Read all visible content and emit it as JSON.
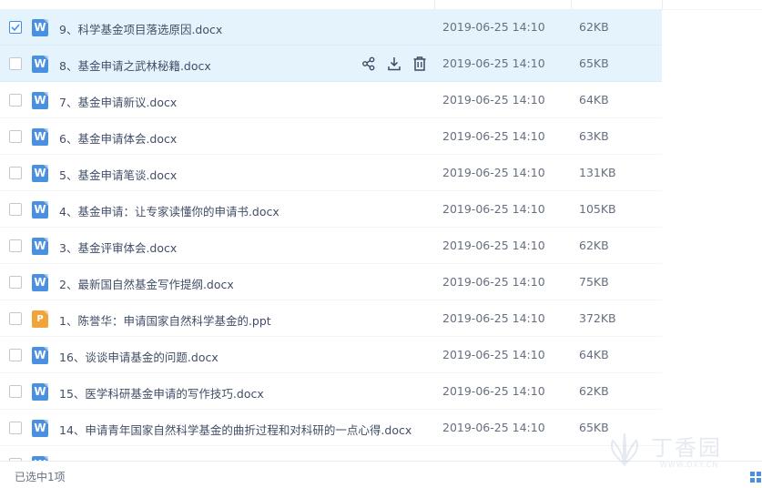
{
  "files": [
    {
      "name": "9、科学基金项目落选原因.docx",
      "date": "2019-06-25 14:10",
      "size": "62KB",
      "type_icon": "W",
      "type": "word",
      "checked": true,
      "highlight": true
    },
    {
      "name": "8、基金申请之武林秘籍.docx",
      "date": "2019-06-25 14:10",
      "size": "65KB",
      "type_icon": "W",
      "type": "word",
      "checked": false,
      "highlight": true,
      "hover_actions": true
    },
    {
      "name": "7、基金申请新议.docx",
      "date": "2019-06-25 14:10",
      "size": "64KB",
      "type_icon": "W",
      "type": "word",
      "checked": false
    },
    {
      "name": "6、基金申请体会.docx",
      "date": "2019-06-25 14:10",
      "size": "63KB",
      "type_icon": "W",
      "type": "word",
      "checked": false
    },
    {
      "name": "5、基金申请笔谈.docx",
      "date": "2019-06-25 14:10",
      "size": "131KB",
      "type_icon": "W",
      "type": "word",
      "checked": false
    },
    {
      "name": "4、基金申请：让专家读懂你的申请书.docx",
      "date": "2019-06-25 14:10",
      "size": "105KB",
      "type_icon": "W",
      "type": "word",
      "checked": false
    },
    {
      "name": "3、基金评审体会.docx",
      "date": "2019-06-25 14:10",
      "size": "62KB",
      "type_icon": "W",
      "type": "word",
      "checked": false
    },
    {
      "name": "2、最新国自然基金写作提纲.docx",
      "date": "2019-06-25 14:10",
      "size": "75KB",
      "type_icon": "W",
      "type": "word",
      "checked": false
    },
    {
      "name": "1、陈誉华：申请国家自然科学基金的.ppt",
      "date": "2019-06-25 14:10",
      "size": "372KB",
      "type_icon": "P",
      "type": "ppt",
      "checked": false
    },
    {
      "name": "16、谈谈申请基金的问题.docx",
      "date": "2019-06-25 14:10",
      "size": "64KB",
      "type_icon": "W",
      "type": "word",
      "checked": false
    },
    {
      "name": "15、医学科研基金申请的写作技巧.docx",
      "date": "2019-06-25 14:10",
      "size": "62KB",
      "type_icon": "W",
      "type": "word",
      "checked": false
    },
    {
      "name": "14、申请青年国家自然科学基金的曲折过程和对科研的一点心得.docx",
      "date": "2019-06-25 14:10",
      "size": "65KB",
      "type_icon": "W",
      "type": "word",
      "checked": false
    },
    {
      "name": "",
      "date": "",
      "size": "",
      "type_icon": "W",
      "type": "word",
      "checked": false,
      "partial": true
    }
  ],
  "row_actions": {
    "share": "share-icon",
    "download": "download-icon",
    "delete": "trash-icon"
  },
  "status": {
    "selected_text": "已选中1项"
  },
  "watermark": {
    "text": "丁香园",
    "url": "WWW.DXY.CN"
  },
  "colors": {
    "accent": "#3b8cff",
    "row_highlight": "#e5f4fc",
    "word_icon": "#4a90e2",
    "ppt_icon": "#f0a43c",
    "action_icon": "#3c4a63"
  }
}
